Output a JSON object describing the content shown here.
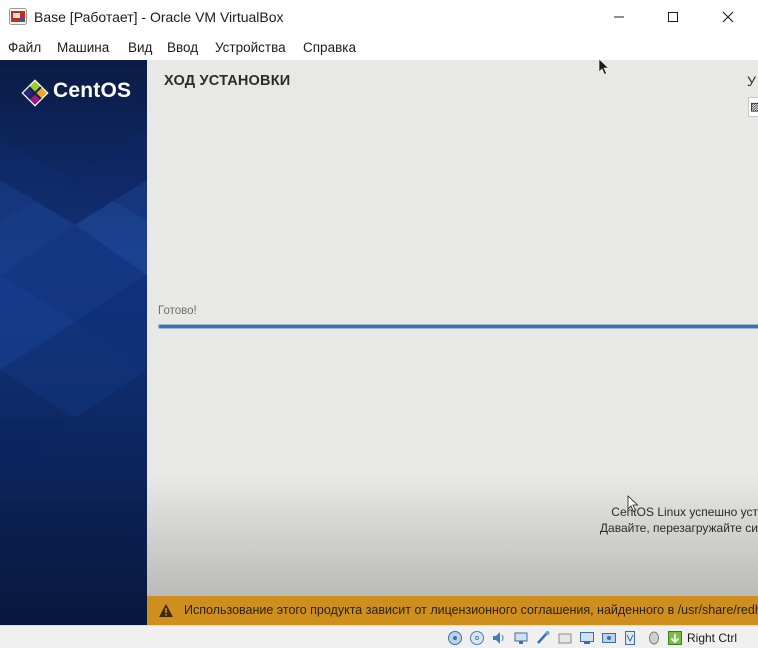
{
  "window": {
    "title": "Base [Работает] - Oracle VM VirtualBox"
  },
  "menu": {
    "items": [
      "Файл",
      "Машина",
      "Вид",
      "Ввод",
      "Устройства",
      "Справка"
    ]
  },
  "installer": {
    "logo_text": "CentOS",
    "heading": "ХОД УСТАНОВКИ",
    "help_letter": "У",
    "status_label": "Готово!",
    "progress": 1.0,
    "done_line1": "CentOS Linux успешно уст",
    "done_line2": "Давайте, перезагружайте си",
    "license_text": "Использование этого продукта зависит от лицензионного соглашения, найденного в /usr/share/redh"
  },
  "statusbar": {
    "host_key": "Right Ctrl",
    "icons": [
      "hard-disk-icon",
      "optical-drive-icon",
      "audio-icon",
      "network-icon",
      "usb-icon",
      "shared-folders-icon",
      "display-icon",
      "video-capture-icon",
      "cpu-icon",
      "mouse-integration-icon",
      "host-key-arrow-icon"
    ]
  },
  "colors": {
    "sidebar_dark": "#0b1d4a",
    "progress": "#3f6fb8",
    "license_bar": "#cf8f1c",
    "background": "#e8e8e7"
  }
}
